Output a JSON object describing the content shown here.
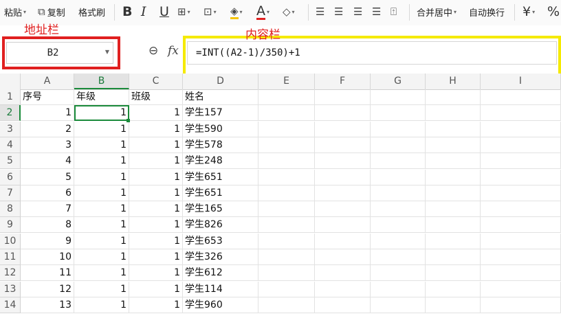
{
  "ribbon": {
    "paste_label": "粘贴",
    "copy_label": "复制",
    "format_painter_label": "格式刷",
    "bold_label": "B",
    "italic_label": "I",
    "underline_label": "U",
    "font_color_label": "A",
    "merge_center_label": "合并居中",
    "wrap_text_label": "自动换行",
    "currency_label": "¥",
    "percent_label": "%"
  },
  "annotations": {
    "address_bar_label": "地址栏",
    "content_bar_label": "内容栏"
  },
  "name_box": {
    "value": "B2"
  },
  "formula_bar": {
    "fx_label": "fx",
    "value": "=INT((A2-1)/350)+1"
  },
  "columns": [
    "A",
    "B",
    "C",
    "D",
    "E",
    "F",
    "G",
    "H",
    "I"
  ],
  "selected_column": "B",
  "row_numbers": [
    "1",
    "2",
    "3",
    "4",
    "5",
    "6",
    "7",
    "8",
    "9",
    "10",
    "11",
    "12",
    "13",
    "14"
  ],
  "selected_row": "2",
  "header_row": [
    "序号",
    "年级",
    "班级",
    "姓名"
  ],
  "rows": [
    [
      "1",
      "1",
      "1",
      "学生157"
    ],
    [
      "2",
      "1",
      "1",
      "学生590"
    ],
    [
      "3",
      "1",
      "1",
      "学生578"
    ],
    [
      "4",
      "1",
      "1",
      "学生248"
    ],
    [
      "5",
      "1",
      "1",
      "学生651"
    ],
    [
      "6",
      "1",
      "1",
      "学生651"
    ],
    [
      "7",
      "1",
      "1",
      "学生165"
    ],
    [
      "8",
      "1",
      "1",
      "学生826"
    ],
    [
      "9",
      "1",
      "1",
      "学生653"
    ],
    [
      "10",
      "1",
      "1",
      "学生326"
    ],
    [
      "11",
      "1",
      "1",
      "学生612"
    ],
    [
      "12",
      "1",
      "1",
      "学生114"
    ],
    [
      "13",
      "1",
      "1",
      "学生960"
    ]
  ],
  "colors": {
    "highlight_red": "#e02020",
    "highlight_yellow": "#f5ea00",
    "selection_green": "#1a8a3a"
  }
}
